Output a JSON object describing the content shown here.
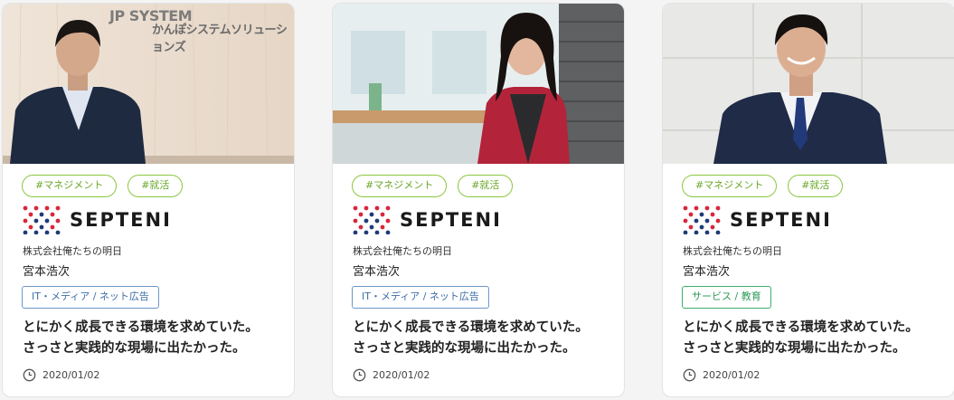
{
  "cards": [
    {
      "photo_sign_text": "かんぽシステムソリューションズ",
      "photo_logo_text": "JP SYSTEM",
      "tags": [
        "#マネジメント",
        "#就活"
      ],
      "logo_text": "SEPTENI",
      "company": "株式会社俺たちの明日",
      "person": "宮本浩次",
      "industry": "IT・メディア / ネット広告",
      "headline_line1": "とにかく成長できる環境を求めていた。",
      "headline_line2": "さっさと実践的な現場に出たかった。",
      "date": "2020/01/02"
    },
    {
      "tags": [
        "#マネジメント",
        "#就活"
      ],
      "logo_text": "SEPTENI",
      "company": "株式会社俺たちの明日",
      "person": "宮本浩次",
      "industry": "IT・メディア / ネット広告",
      "headline_line1": "とにかく成長できる環境を求めていた。",
      "headline_line2": "さっさと実践的な現場に出たかった。",
      "date": "2020/01/02"
    },
    {
      "tags": [
        "#マネジメント",
        "#就活"
      ],
      "logo_text": "SEPTENI",
      "company": "株式会社俺たちの明日",
      "person": "宮本浩次",
      "industry": "サービス / 教育",
      "headline_line1": "とにかく成長できる環境を求めていた。",
      "headline_line2": "さっさと実践的な現場に出たかった。",
      "date": "2020/01/02"
    }
  ],
  "colors": {
    "tag_green": "#8cc63f",
    "industry_blue": "#6d97c9",
    "industry_green": "#3fae6b",
    "logo_red": "#d9263b",
    "logo_navy": "#1e3a78"
  },
  "icons": {
    "date": "clock-icon"
  }
}
